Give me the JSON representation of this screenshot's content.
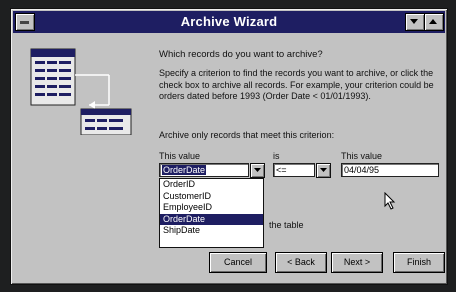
{
  "window": {
    "title": "Archive Wizard"
  },
  "wizard": {
    "question": "Which records do you want to archive?",
    "description": "Specify a criterion to find the records you want to archive, or click the check box to archive all records.  For example, your criterion could be orders dated before 1993 (Order Date < 01/01/1993).",
    "criterion_label": "Archive only records that meet this criterion:"
  },
  "criteria": {
    "field_label": "This value",
    "operator_label": "is",
    "value_label": "This value",
    "field_value": "OrderDate",
    "operator_value": "<=",
    "value_value": "04/04/95"
  },
  "field_list": {
    "items": [
      "OrderID",
      "CustomerID",
      "EmployeeID",
      "OrderDate",
      "ShipDate"
    ],
    "highlighted_index": 3
  },
  "partial_text": "the table",
  "buttons": {
    "cancel": "Cancel",
    "back": "< Back",
    "next": "Next >",
    "finish": "Finish"
  },
  "colors": {
    "titlebar": "#1e1e62",
    "dialog_face": "#c2c2c2",
    "selection": "#1e1e62"
  }
}
